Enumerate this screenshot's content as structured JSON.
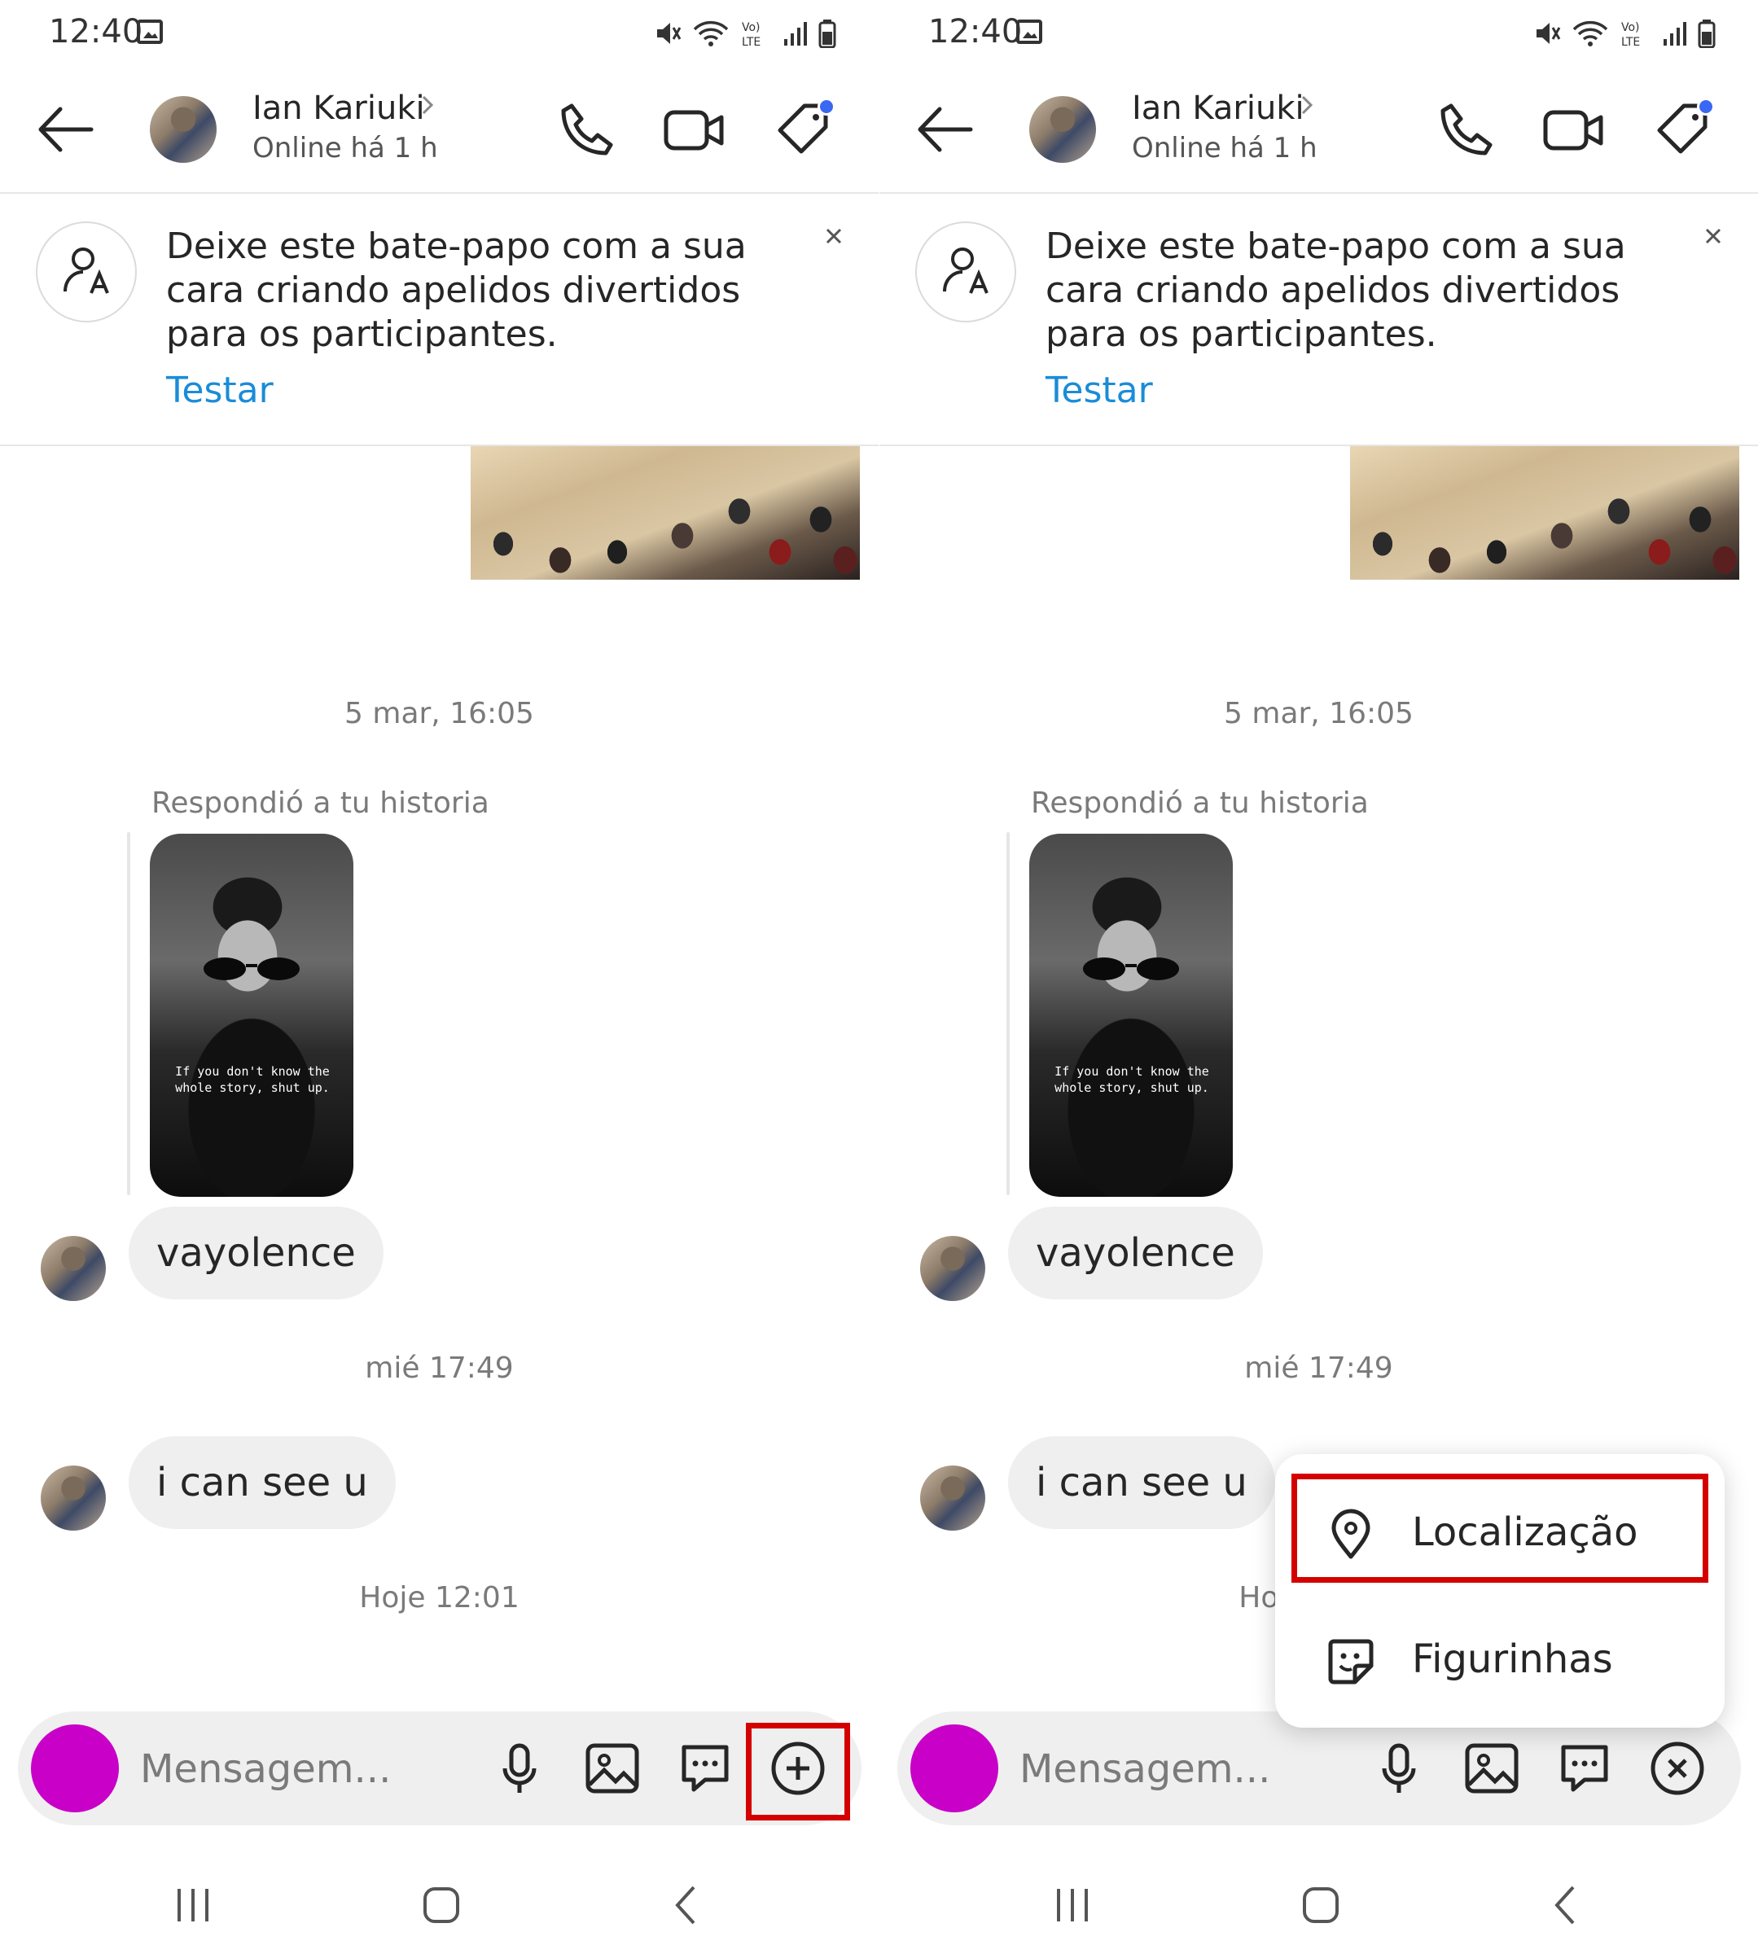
{
  "status_bar": {
    "time": "12:40",
    "signal_label": "Vo) LTE"
  },
  "header": {
    "contact_name": "Ian Kariuki",
    "contact_status": "Online há 1 h"
  },
  "banner": {
    "text": "Deixe este bate-papo com a sua cara criando apelidos divertidos para os participantes.",
    "link": "Testar",
    "close": "×"
  },
  "thread": {
    "timestamps": [
      "5 mar, 16:05",
      "mié 17:49",
      "Hoje 12:01"
    ],
    "story_reply_label": "Respondió a tu historia",
    "story_caption": "If you don't know the whole story, shut up.",
    "messages": [
      "vayolence",
      "i can see u"
    ]
  },
  "composer": {
    "placeholder": "Mensagem..."
  },
  "popup_menu": {
    "items": [
      {
        "label": "Localização",
        "icon": "location-pin-icon"
      },
      {
        "label": "Figurinhas",
        "icon": "sticker-icon"
      }
    ]
  },
  "colors": {
    "link_blue": "#1a8cd8",
    "composer_avatar": "#c800c8",
    "highlight_red": "#d40000",
    "notification_dot": "#3a68f2"
  }
}
